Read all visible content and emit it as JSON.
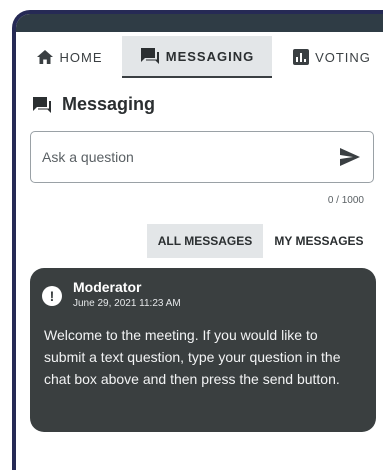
{
  "tabs": [
    {
      "label": "HOME",
      "icon": "home-icon"
    },
    {
      "label": "MESSAGING",
      "icon": "message-icon"
    },
    {
      "label": "VOTING",
      "icon": "poll-icon"
    }
  ],
  "section": {
    "title": "Messaging",
    "icon": "message-icon"
  },
  "input": {
    "placeholder": "Ask a question",
    "value": "",
    "counter": "0 / 1000",
    "send_icon": "send-icon"
  },
  "filters": [
    {
      "label": "ALL MESSAGES",
      "active": true
    },
    {
      "label": "MY MESSAGES",
      "active": false
    }
  ],
  "message": {
    "author": "Moderator",
    "timestamp": "June 29, 2021 11:23 AM",
    "text": "Welcome to the meeting. If you would like to submit a text question, type your question in the chat box above and then press the send button.",
    "icon": "alert-icon"
  },
  "colors": {
    "frame": "#262a55",
    "topbar": "#2f3c45",
    "card": "#3a3f40",
    "active_tab": "#e3e6e8"
  }
}
